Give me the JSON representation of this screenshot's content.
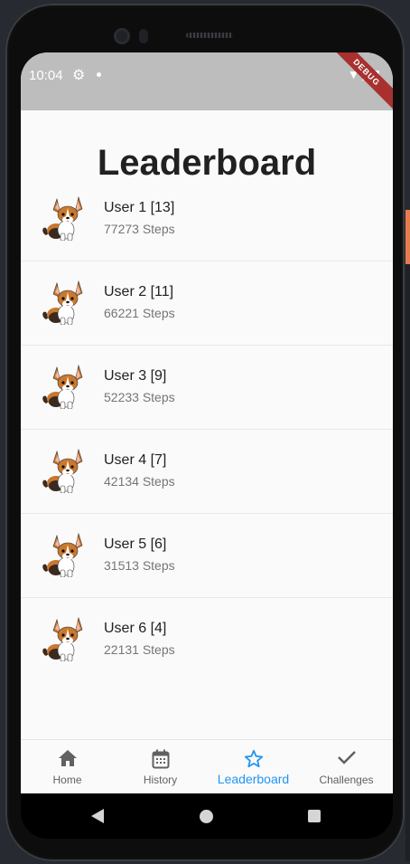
{
  "status_bar": {
    "time": "10:04",
    "debug_label": "DEBUG"
  },
  "page": {
    "title": "Leaderboard"
  },
  "leaderboard": [
    {
      "name": "User 1 [13]",
      "steps": "77273 Steps"
    },
    {
      "name": "User 2 [11]",
      "steps": "66221 Steps"
    },
    {
      "name": "User 3 [9]",
      "steps": "52233 Steps"
    },
    {
      "name": "User 4 [7]",
      "steps": "42134 Steps"
    },
    {
      "name": "User 5 [6]",
      "steps": "31513 Steps"
    },
    {
      "name": "User 6 [4]",
      "steps": "22131 Steps"
    }
  ],
  "bottom_nav": [
    {
      "label": "Home",
      "icon": "home-icon"
    },
    {
      "label": "History",
      "icon": "calendar-icon"
    },
    {
      "label": "Leaderboard",
      "icon": "star-icon",
      "active": true
    },
    {
      "label": "Challenges",
      "icon": "check-icon"
    }
  ],
  "colors": {
    "accent": "#2196f3",
    "status_bar": "#bdbdbd",
    "debug_ribbon": "#a8312f"
  }
}
